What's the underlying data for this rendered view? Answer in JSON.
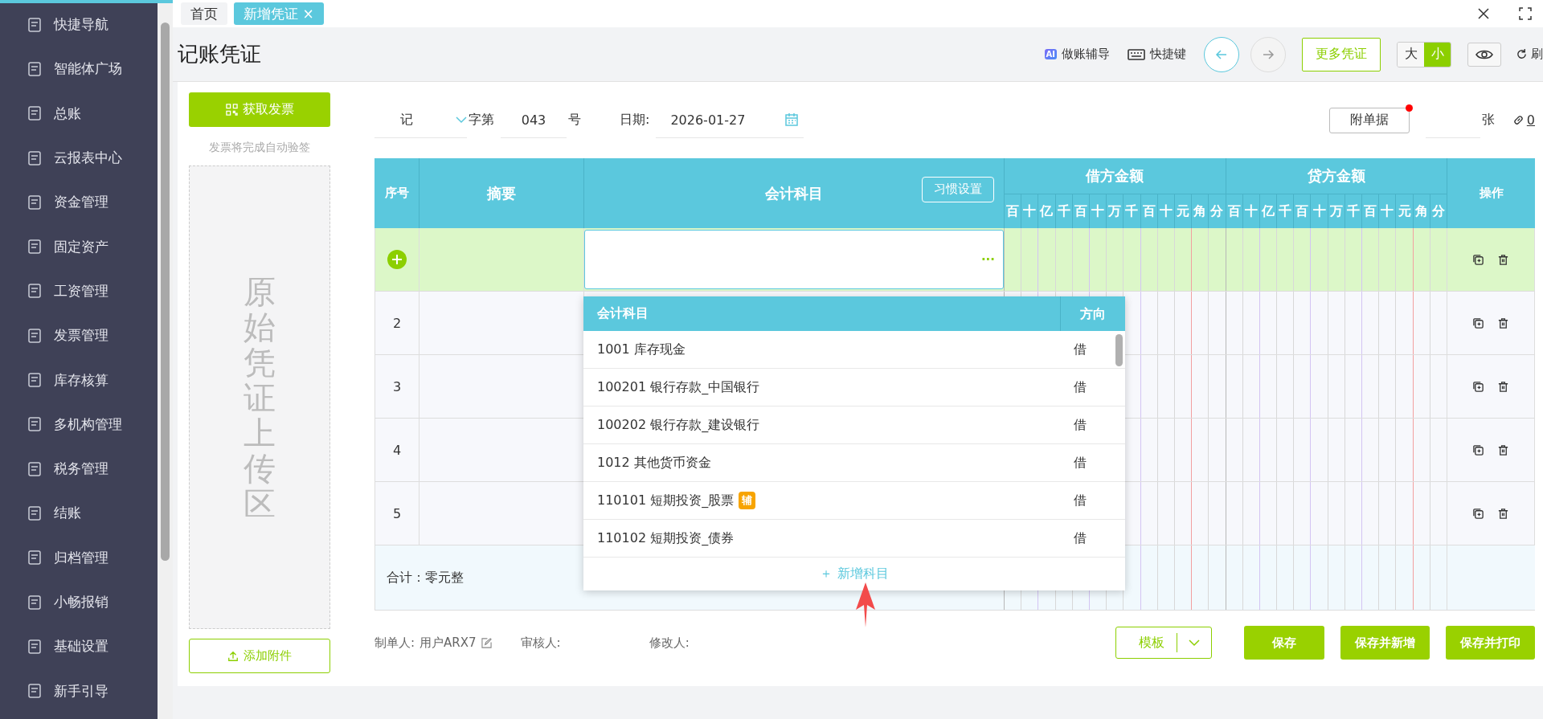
{
  "sidebar": {
    "items": [
      {
        "label": "快捷导航",
        "selected": false
      },
      {
        "label": "智能体广场",
        "selected": false
      },
      {
        "label": "总账",
        "selected": false
      },
      {
        "label": "云报表中心",
        "selected": false
      },
      {
        "label": "资金管理",
        "selected": false
      },
      {
        "label": "固定资产",
        "selected": false
      },
      {
        "label": "工资管理",
        "selected": false
      },
      {
        "label": "发票管理",
        "selected": false
      },
      {
        "label": "库存核算",
        "selected": false
      },
      {
        "label": "多机构管理",
        "selected": false
      },
      {
        "label": "税务管理",
        "selected": false
      },
      {
        "label": "结账",
        "selected": false
      },
      {
        "label": "归档管理",
        "selected": false
      },
      {
        "label": "小畅报销",
        "selected": false
      },
      {
        "label": "基础设置",
        "selected": false
      },
      {
        "label": "新手引导",
        "selected": false
      }
    ]
  },
  "tabs": [
    {
      "label": "首页",
      "selected": false
    },
    {
      "label": "新增凭证",
      "selected": true,
      "close": "×"
    }
  ],
  "header": {
    "title": "记账凭证",
    "ai_badge": "AI",
    "guide": "做账辅导",
    "shortcuts": "快捷键",
    "back_enabled": true,
    "forward_enabled": false,
    "more": "更多凭证",
    "sizes": [
      {
        "label": "大",
        "selected": false
      },
      {
        "label": "小",
        "selected": true
      }
    ],
    "refresh": "刷"
  },
  "upload": {
    "invoice_button": "获取发票",
    "note": "发票将完成自动验签",
    "area_label": "原始凭证上传区",
    "attach_button": "添加附件"
  },
  "form": {
    "word": "记",
    "word_suffix": "字第",
    "number": "043",
    "number_suffix": "号",
    "date_label": "日期:",
    "date": "2026-01-27",
    "attachment_button": "附单据",
    "attachment_dot": true,
    "count_unit": "张",
    "link_count": "0"
  },
  "table": {
    "columns": {
      "index": "序号",
      "summary": "摘要",
      "subject": "会计科目",
      "habit_button": "习惯设置",
      "debit": "借方金额",
      "credit": "贷方金额",
      "actions": "操作"
    },
    "debit_digits": [
      "百",
      "十",
      "亿",
      "千",
      "百",
      "十",
      "万",
      "千",
      "百",
      "十",
      "元",
      "角",
      "分"
    ],
    "credit_digits": [
      "百",
      "十",
      "亿",
      "千",
      "百",
      "十",
      "万",
      "千",
      "百",
      "十",
      "元",
      "角",
      "分"
    ],
    "rows": [
      {
        "active": true,
        "more": "···"
      },
      {
        "active": false,
        "number": "2"
      },
      {
        "active": false,
        "number": "3"
      },
      {
        "active": false,
        "number": "4"
      },
      {
        "active": false,
        "number": "5"
      }
    ],
    "total": "合计：零元整"
  },
  "subject_dropdown": {
    "columns": [
      "会计科目",
      "方向"
    ],
    "items": [
      {
        "subject": "1001 库存现金",
        "direction": "借"
      },
      {
        "subject": "100201 银行存款_中国银行",
        "direction": "借"
      },
      {
        "subject": "100202 银行存款_建设银行",
        "direction": "借"
      },
      {
        "subject": "1012 其他货币资金",
        "direction": "借"
      },
      {
        "subject": "110101 短期投资_股票",
        "badge": "辅",
        "direction": "借"
      },
      {
        "subject": "110102 短期投资_债券",
        "direction": "借"
      }
    ],
    "add": "＋ 新增科目"
  },
  "footer": {
    "maker_label": "制单人:",
    "maker": "用户ARX7",
    "reviewer_label": "审核人:",
    "modifier_label": "修改人:",
    "template": "模板",
    "buttons": [
      "保存",
      "保存并新增",
      "保存并打印"
    ]
  }
}
